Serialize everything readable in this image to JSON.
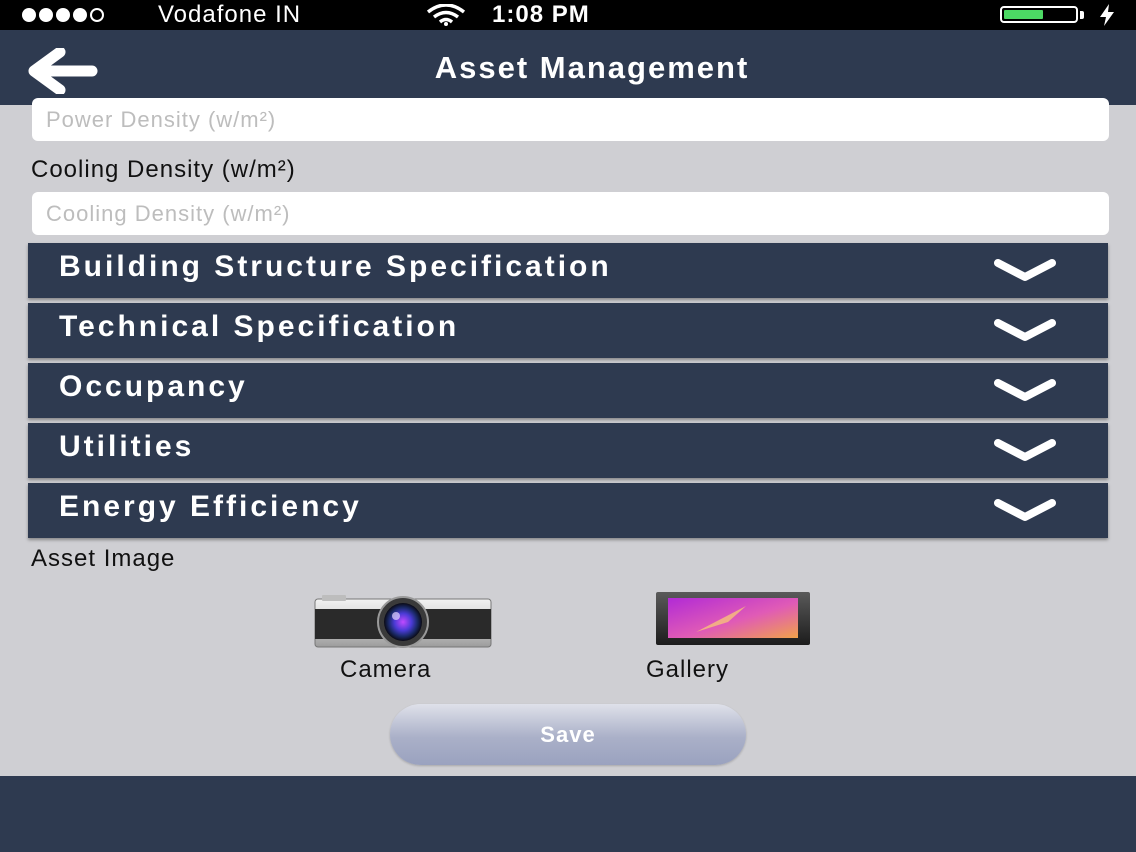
{
  "status_bar": {
    "carrier": "Vodafone IN",
    "time": "1:08 PM",
    "signal_bars_filled": 4,
    "signal_bars_total": 5,
    "battery_level": 0.55,
    "battery_color": "#4cd964"
  },
  "header": {
    "title": "Asset Management",
    "back_icon": "chevron-left-icon",
    "background": "#2e3a50"
  },
  "form": {
    "power_density": {
      "placeholder": "Power Density (w/m²)",
      "value": ""
    },
    "cooling_density": {
      "label": "Cooling Density (w/m²)",
      "placeholder": "Cooling Density (w/m²)",
      "value": ""
    }
  },
  "sections": [
    {
      "label": "Building Structure Specification"
    },
    {
      "label": "Technical Specification"
    },
    {
      "label": "Occupancy"
    },
    {
      "label": "Utilities"
    },
    {
      "label": "Energy Efficiency"
    }
  ],
  "asset_image": {
    "label": "Asset Image",
    "camera_label": "Camera",
    "gallery_label": "Gallery"
  },
  "save_label": "Save"
}
